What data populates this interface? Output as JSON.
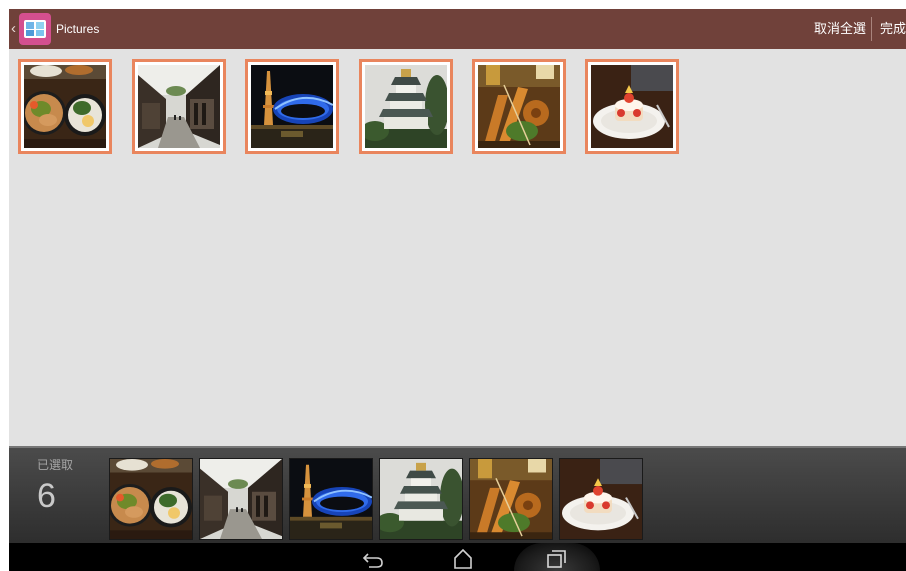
{
  "action_bar": {
    "back_glyph": "‹",
    "app_icon": "gallery-app-icon",
    "title": "Pictures",
    "deselect_all_label": "取消全選",
    "done_label": "完成",
    "background_color": "#70413a"
  },
  "gallery": {
    "selection_border_color": "#e9855d",
    "thumbnails": [
      {
        "subject": "ramen-bowls-photo"
      },
      {
        "subject": "old-street-photo"
      },
      {
        "subject": "night-tower-photo"
      },
      {
        "subject": "castle-photo"
      },
      {
        "subject": "fried-skewers-photo"
      },
      {
        "subject": "strawberry-cake-photo"
      }
    ]
  },
  "tray": {
    "selected_label": "已選取",
    "selected_count": "6"
  },
  "navbar": {
    "back_icon": "back-icon",
    "home_icon": "home-icon",
    "recent_icon": "recent-apps-icon"
  }
}
